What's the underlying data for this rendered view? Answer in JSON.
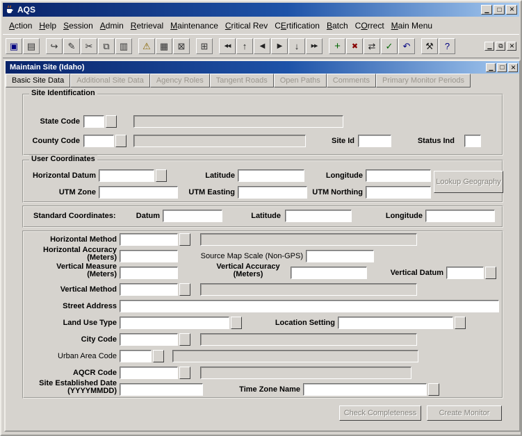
{
  "window": {
    "title": "AQS",
    "icon": "java-coffee-icon",
    "controls": [
      "minimize-icon",
      "maximize-icon",
      "close-icon"
    ]
  },
  "colors": {
    "titlebar_start": "#0a246a",
    "titlebar_end": "#a6caf0",
    "chrome_gray": "#d6d3ce",
    "disabled_text": "#9a968e"
  },
  "menu": {
    "items": [
      {
        "label": "Action",
        "mnemonic": 0
      },
      {
        "label": "Help",
        "mnemonic": 0
      },
      {
        "label": "Session",
        "mnemonic": 0
      },
      {
        "label": "Admin",
        "mnemonic": 0
      },
      {
        "label": "Retrieval",
        "mnemonic": 0
      },
      {
        "label": "Maintenance",
        "mnemonic": 0
      },
      {
        "label": "Critical Rev",
        "mnemonic": 0
      },
      {
        "label": "CErtification",
        "mnemonic": 1
      },
      {
        "label": "Batch",
        "mnemonic": 0
      },
      {
        "label": "COrrect",
        "mnemonic": 1
      },
      {
        "label": "Main Menu",
        "mnemonic": 0
      }
    ]
  },
  "toolbar": {
    "buttons": [
      {
        "icon": "save-icon",
        "group": 1
      },
      {
        "icon": "print-icon",
        "group": 1
      },
      {
        "icon": "exit-icon",
        "group": 2
      },
      {
        "icon": "edit-icon",
        "group": 2
      },
      {
        "icon": "cut-icon",
        "group": 2
      },
      {
        "icon": "copy-icon",
        "group": 2
      },
      {
        "icon": "paste-icon",
        "group": 2
      },
      {
        "icon": "display-error-icon",
        "group": 3
      },
      {
        "icon": "duplicate-record-icon",
        "group": 3
      },
      {
        "icon": "clear-record-icon",
        "group": 3
      },
      {
        "icon": "list-values-icon",
        "group": 4
      },
      {
        "icon": "first-record-icon",
        "group": 5
      },
      {
        "icon": "scroll-up-icon",
        "group": 5
      },
      {
        "icon": "previous-record-icon",
        "group": 5
      },
      {
        "icon": "next-record-icon",
        "group": 5
      },
      {
        "icon": "scroll-down-icon",
        "group": 5
      },
      {
        "icon": "last-record-icon",
        "group": 5
      },
      {
        "icon": "insert-record-icon",
        "group": 6
      },
      {
        "icon": "remove-record-icon",
        "group": 6
      },
      {
        "icon": "lock-record-icon",
        "group": 6
      },
      {
        "icon": "commit-icon",
        "group": 6
      },
      {
        "icon": "rollback-icon",
        "group": 6
      },
      {
        "icon": "tools-icon",
        "group": 7
      },
      {
        "icon": "help-icon",
        "group": 7
      }
    ],
    "window_controls": [
      "minimize-icon",
      "restore-icon",
      "close-icon"
    ]
  },
  "child_window": {
    "title": "Maintain Site (Idaho)",
    "controls": [
      "minimize-icon",
      "maximize-icon",
      "close-icon"
    ]
  },
  "tabs": {
    "items": [
      {
        "label": "Basic Site Data",
        "active": true,
        "enabled": true
      },
      {
        "label": "Additional Site Data",
        "active": false,
        "enabled": false
      },
      {
        "label": "Agency Roles",
        "active": false,
        "enabled": false
      },
      {
        "label": "Tangent Roads",
        "active": false,
        "enabled": false
      },
      {
        "label": "Open Paths",
        "active": false,
        "enabled": false
      },
      {
        "label": "Comments",
        "active": false,
        "enabled": false
      },
      {
        "label": "Primary Monitor Periods",
        "active": false,
        "enabled": false
      }
    ]
  },
  "form": {
    "site_identification": {
      "title": "Site Identification",
      "state_code": {
        "label": "State Code",
        "value": "",
        "desc_value": ""
      },
      "county_code": {
        "label": "County Code",
        "value": "",
        "desc_value": ""
      },
      "site_id": {
        "label": "Site Id",
        "value": ""
      },
      "status_ind": {
        "label": "Status Ind",
        "value": ""
      }
    },
    "user_coordinates": {
      "title": "User Coordinates",
      "horizontal_datum": {
        "label": "Horizontal Datum",
        "value": ""
      },
      "latitude": {
        "label": "Latitude",
        "value": ""
      },
      "longitude": {
        "label": "Longitude",
        "value": ""
      },
      "utm_zone": {
        "label": "UTM Zone",
        "value": ""
      },
      "utm_easting": {
        "label": "UTM Easting",
        "value": ""
      },
      "utm_northing": {
        "label": "UTM Northing",
        "value": ""
      },
      "lookup_geography_button": "Lookup Geography"
    },
    "standard_coordinates": {
      "title": "Standard Coordinates:",
      "datum": {
        "label": "Datum",
        "value": ""
      },
      "latitude": {
        "label": "Latitude",
        "value": ""
      },
      "longitude": {
        "label": "Longitude",
        "value": ""
      }
    },
    "details": {
      "horizontal_method": {
        "label": "Horizontal Method",
        "value": "",
        "desc_value": ""
      },
      "horizontal_accuracy": {
        "label": "Horizontal Accuracy",
        "sublabel": "(Meters)",
        "value": ""
      },
      "source_map_scale": {
        "label": "Source Map Scale (Non-GPS)",
        "value": ""
      },
      "vertical_measure": {
        "label": "Vertical Measure",
        "sublabel": "(Meters)",
        "value": ""
      },
      "vertical_accuracy": {
        "label": "Vertical Accuracy",
        "sublabel": "(Meters)",
        "value": ""
      },
      "vertical_datum": {
        "label": "Vertical Datum",
        "value": ""
      },
      "vertical_method": {
        "label": "Vertical Method",
        "value": "",
        "desc_value": ""
      },
      "street_address": {
        "label": "Street Address",
        "value": ""
      },
      "land_use_type": {
        "label": "Land Use Type",
        "value": ""
      },
      "location_setting": {
        "label": "Location Setting",
        "value": ""
      },
      "city_code": {
        "label": "City Code",
        "value": "",
        "desc_value": ""
      },
      "urban_area_code": {
        "label": "Urban Area Code",
        "value": "",
        "desc_value": ""
      },
      "aqcr_code": {
        "label": "AQCR Code",
        "value": "",
        "desc_value": ""
      },
      "site_established_date": {
        "label": "Site Established Date",
        "sublabel": "(YYYYMMDD)",
        "value": ""
      },
      "time_zone_name": {
        "label": "Time Zone Name",
        "value": ""
      }
    },
    "actions": {
      "check_completeness": "Check Completeness",
      "create_monitor": "Create Monitor"
    }
  }
}
